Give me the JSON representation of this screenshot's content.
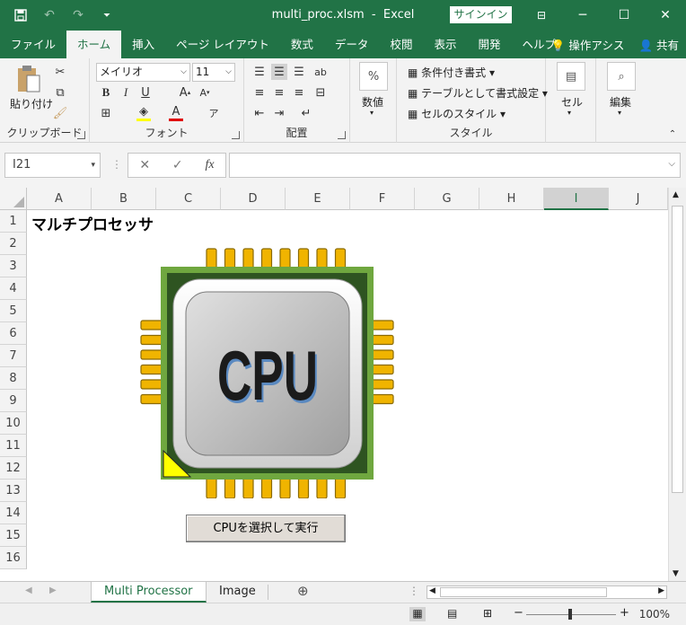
{
  "window": {
    "filename": "multi_proc.xlsm",
    "app": "Excel",
    "signin": "サインイン"
  },
  "ribbon_tabs": [
    "ファイル",
    "ホーム",
    "挿入",
    "ページ レイアウト",
    "数式",
    "データ",
    "校閲",
    "表示",
    "開発",
    "ヘルプ"
  ],
  "ribbon_right": {
    "tellme": "操作アシス",
    "share": "共有"
  },
  "clipboard": {
    "paste": "貼り付け",
    "label": "クリップボード"
  },
  "font": {
    "name": "メイリオ",
    "size": "11",
    "label": "フォント"
  },
  "alignment": {
    "label": "配置"
  },
  "number": {
    "big": "数値"
  },
  "styles": {
    "conditional": "条件付き書式",
    "table": "テーブルとして書式設定",
    "cell_styles": "セルのスタイル",
    "label": "スタイル"
  },
  "cells": {
    "big": "セル"
  },
  "editing": {
    "big": "編集"
  },
  "namebox": "I21",
  "columns": [
    "A",
    "B",
    "C",
    "D",
    "E",
    "F",
    "G",
    "H",
    "I",
    "J"
  ],
  "rows": [
    "1",
    "2",
    "3",
    "4",
    "5",
    "6",
    "7",
    "8",
    "9",
    "10",
    "11",
    "12",
    "13",
    "14",
    "15",
    "16"
  ],
  "selected_column": "I",
  "sheet_title": "マルチプロセッサ",
  "cpu_text": "CPU",
  "run_button": "CPUを選択して実行",
  "sheets": [
    "Multi Processor",
    "Image"
  ],
  "active_sheet": "Multi Processor",
  "zoom": "100%",
  "colors": {
    "excel_green": "#217346",
    "pin": "#F0B400",
    "board": "#6FA73F"
  }
}
